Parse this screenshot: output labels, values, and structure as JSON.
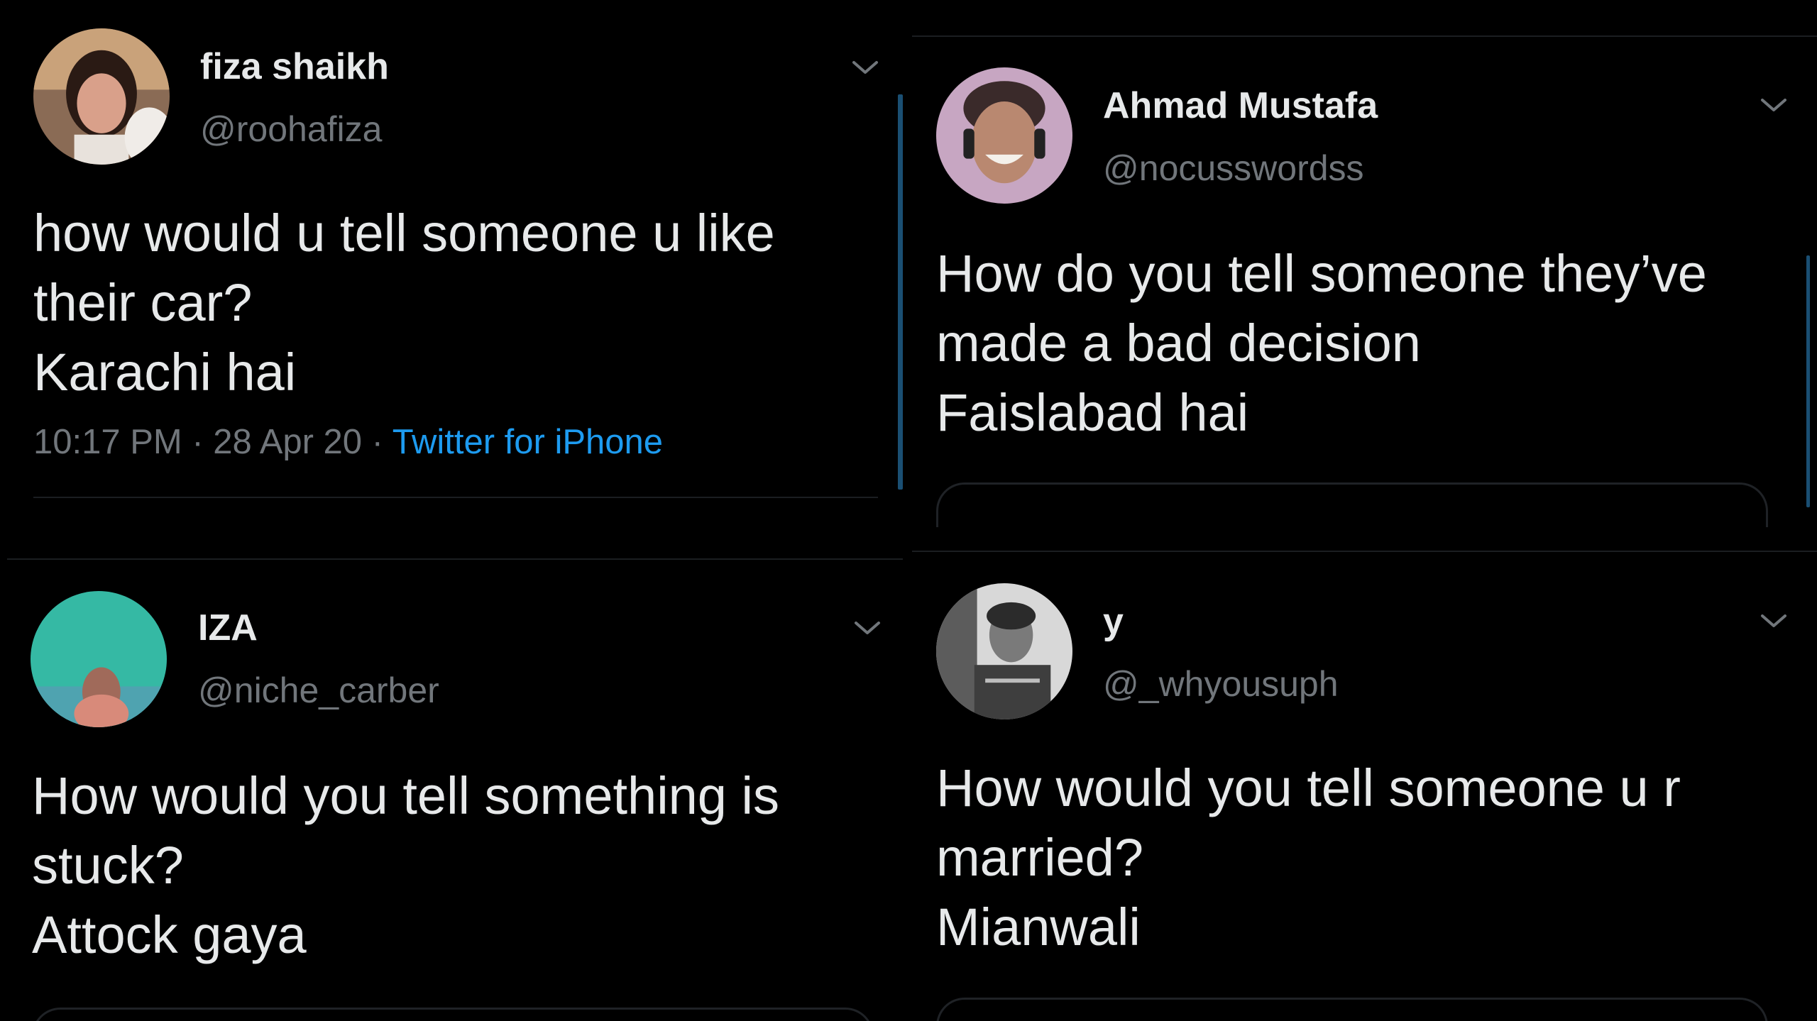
{
  "tweets": [
    {
      "name": "fiza shaikh",
      "handle": "@roohafiza",
      "lines": [
        "how would u tell someone u like",
        "their car?",
        "Karachi hai"
      ],
      "time": "10:17 PM",
      "sep1": " · ",
      "date": "28 Apr 20",
      "sep2": " · ",
      "source": "Twitter for iPhone"
    },
    {
      "name": "Ahmad Mustafa",
      "handle": "@nocusswordss",
      "lines": [
        "How do you tell someone they’ve",
        "made a bad decision",
        "Faislabad hai"
      ]
    },
    {
      "name": "IZA",
      "handle": "@niche_carber",
      "lines": [
        "How would you tell something is",
        "stuck?",
        "Attock gaya"
      ]
    },
    {
      "name": "y",
      "handle": "@_whyousuph",
      "lines": [
        "How would you tell someone u r",
        "married?",
        "Mianwali"
      ]
    }
  ],
  "icons": {
    "menu": "chevron-down-icon",
    "avatar": "avatar"
  },
  "colors": {
    "background": "#000000",
    "text": "#e7e9ea",
    "secondary": "#71767b",
    "link": "#1d9bf0",
    "thread_line": "#1a4f73"
  }
}
